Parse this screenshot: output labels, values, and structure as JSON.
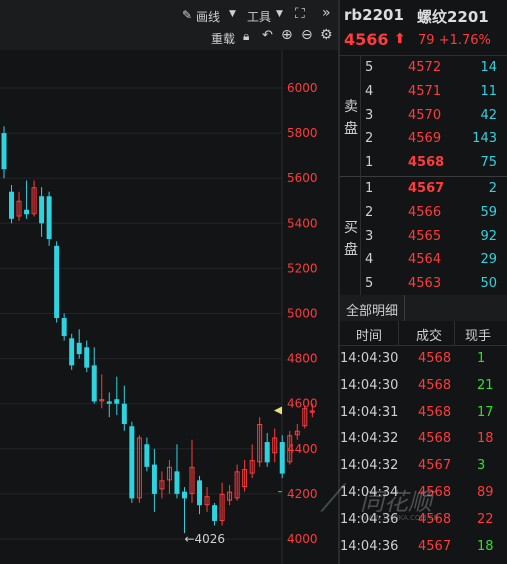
{
  "toolbar": {
    "draw_label": "画线",
    "tools_label": "工具",
    "reload_label": "重载"
  },
  "header": {
    "symbol": "rb2201",
    "name": "螺纹2201",
    "price": "4566",
    "change": "79",
    "change_pct": "+1.76%"
  },
  "orderbook": {
    "sell_label": "卖盘",
    "buy_label": "买盘",
    "asks": [
      {
        "level": "5",
        "price": "4572",
        "vol": "14"
      },
      {
        "level": "4",
        "price": "4571",
        "vol": "11"
      },
      {
        "level": "3",
        "price": "4570",
        "vol": "42"
      },
      {
        "level": "2",
        "price": "4569",
        "vol": "143"
      },
      {
        "level": "1",
        "price": "4568",
        "vol": "75"
      }
    ],
    "bids": [
      {
        "level": "1",
        "price": "4567",
        "vol": "2"
      },
      {
        "level": "2",
        "price": "4566",
        "vol": "59"
      },
      {
        "level": "3",
        "price": "4565",
        "vol": "92"
      },
      {
        "level": "4",
        "price": "4564",
        "vol": "29"
      },
      {
        "level": "5",
        "price": "4563",
        "vol": "50"
      }
    ]
  },
  "ticks": {
    "tab_label": "全部明细",
    "col_time": "时间",
    "col_price": "成交",
    "col_vol": "现手",
    "rows": [
      {
        "time": "14:04:30",
        "price": "4568",
        "vol": "1",
        "up": false
      },
      {
        "time": "14:04:30",
        "price": "4568",
        "vol": "21",
        "up": false
      },
      {
        "time": "14:04:31",
        "price": "4568",
        "vol": "17",
        "up": false
      },
      {
        "time": "14:04:32",
        "price": "4568",
        "vol": "18",
        "up": true
      },
      {
        "time": "14:04:32",
        "price": "4567",
        "vol": "3",
        "up": false
      },
      {
        "time": "14:04:34",
        "price": "4568",
        "vol": "89",
        "up": true
      },
      {
        "time": "14:04:36",
        "price": "4568",
        "vol": "22",
        "up": true
      },
      {
        "time": "14:04:36",
        "price": "4567",
        "vol": "18",
        "up": false
      }
    ]
  },
  "watermark": {
    "brand": "同花顺",
    "url": "WWW.10JQKA.COM.CN"
  },
  "colors": {
    "up": "#ff3b3b",
    "down": "#2fd3e0",
    "vol_down": "#2fdf2f",
    "bg": "#131416"
  },
  "chart_data": {
    "type": "candlestick",
    "y_ticks": [
      "6000",
      "5800",
      "5600",
      "5400",
      "5200",
      "5000",
      "4800",
      "4600",
      "4400",
      "4200",
      "4000"
    ],
    "ylim": [
      3950,
      6100
    ],
    "low_marker": "←4026",
    "candles": [
      {
        "o": 5800,
        "c": 5640,
        "h": 5830,
        "l": 5600
      },
      {
        "o": 5540,
        "c": 5420,
        "h": 5570,
        "l": 5400
      },
      {
        "o": 5430,
        "c": 5500,
        "h": 5540,
        "l": 5410
      },
      {
        "o": 5460,
        "c": 5440,
        "h": 5590,
        "l": 5420
      },
      {
        "o": 5440,
        "c": 5560,
        "h": 5590,
        "l": 5430
      },
      {
        "o": 5520,
        "c": 5400,
        "h": 5560,
        "l": 5340
      },
      {
        "o": 5520,
        "c": 5330,
        "h": 5540,
        "l": 5300
      },
      {
        "o": 5300,
        "c": 4980,
        "h": 5320,
        "l": 4960
      },
      {
        "o": 4980,
        "c": 4900,
        "h": 5000,
        "l": 4880
      },
      {
        "o": 4890,
        "c": 4770,
        "h": 4910,
        "l": 4750
      },
      {
        "o": 4870,
        "c": 4820,
        "h": 4930,
        "l": 4800
      },
      {
        "o": 4850,
        "c": 4760,
        "h": 4880,
        "l": 4740
      },
      {
        "o": 4770,
        "c": 4610,
        "h": 4850,
        "l": 4600
      },
      {
        "o": 4610,
        "c": 4620,
        "h": 4730,
        "l": 4580
      },
      {
        "o": 4610,
        "c": 4600,
        "h": 4650,
        "l": 4540
      },
      {
        "o": 4620,
        "c": 4600,
        "h": 4720,
        "l": 4550
      },
      {
        "o": 4600,
        "c": 4510,
        "h": 4680,
        "l": 4480
      },
      {
        "o": 4500,
        "c": 4180,
        "h": 4520,
        "l": 4160
      },
      {
        "o": 4180,
        "c": 4450,
        "h": 4460,
        "l": 4160
      },
      {
        "o": 4420,
        "c": 4320,
        "h": 4450,
        "l": 4300
      },
      {
        "o": 4330,
        "c": 4200,
        "h": 4400,
        "l": 4120
      },
      {
        "o": 4220,
        "c": 4260,
        "h": 4300,
        "l": 4180
      },
      {
        "o": 4260,
        "c": 4320,
        "h": 4350,
        "l": 4200
      },
      {
        "o": 4300,
        "c": 4200,
        "h": 4420,
        "l": 4180
      },
      {
        "o": 4210,
        "c": 4180,
        "h": 4230,
        "l": 4026
      },
      {
        "o": 4200,
        "c": 4320,
        "h": 4440,
        "l": 4160
      },
      {
        "o": 4260,
        "c": 4150,
        "h": 4280,
        "l": 4110
      },
      {
        "o": 4150,
        "c": 4190,
        "h": 4230,
        "l": 4120
      },
      {
        "o": 4150,
        "c": 4080,
        "h": 4160,
        "l": 4060
      },
      {
        "o": 4080,
        "c": 4200,
        "h": 4250,
        "l": 4060
      },
      {
        "o": 4170,
        "c": 4210,
        "h": 4240,
        "l": 4150
      },
      {
        "o": 4180,
        "c": 4300,
        "h": 4330,
        "l": 4170
      },
      {
        "o": 4230,
        "c": 4310,
        "h": 4350,
        "l": 4210
      },
      {
        "o": 4290,
        "c": 4350,
        "h": 4420,
        "l": 4270
      },
      {
        "o": 4340,
        "c": 4510,
        "h": 4540,
        "l": 4320
      },
      {
        "o": 4430,
        "c": 4340,
        "h": 4470,
        "l": 4320
      },
      {
        "o": 4380,
        "c": 4450,
        "h": 4490,
        "l": 4340
      },
      {
        "o": 4430,
        "c": 4290,
        "h": 4460,
        "l": 4270
      },
      {
        "o": 4340,
        "c": 4460,
        "h": 4480,
        "l": 4330
      },
      {
        "o": 4460,
        "c": 4480,
        "h": 4510,
        "l": 4440
      },
      {
        "o": 4500,
        "c": 4580,
        "h": 4590,
        "l": 4490
      },
      {
        "o": 4560,
        "c": 4570,
        "h": 4600,
        "l": 4540
      }
    ]
  }
}
